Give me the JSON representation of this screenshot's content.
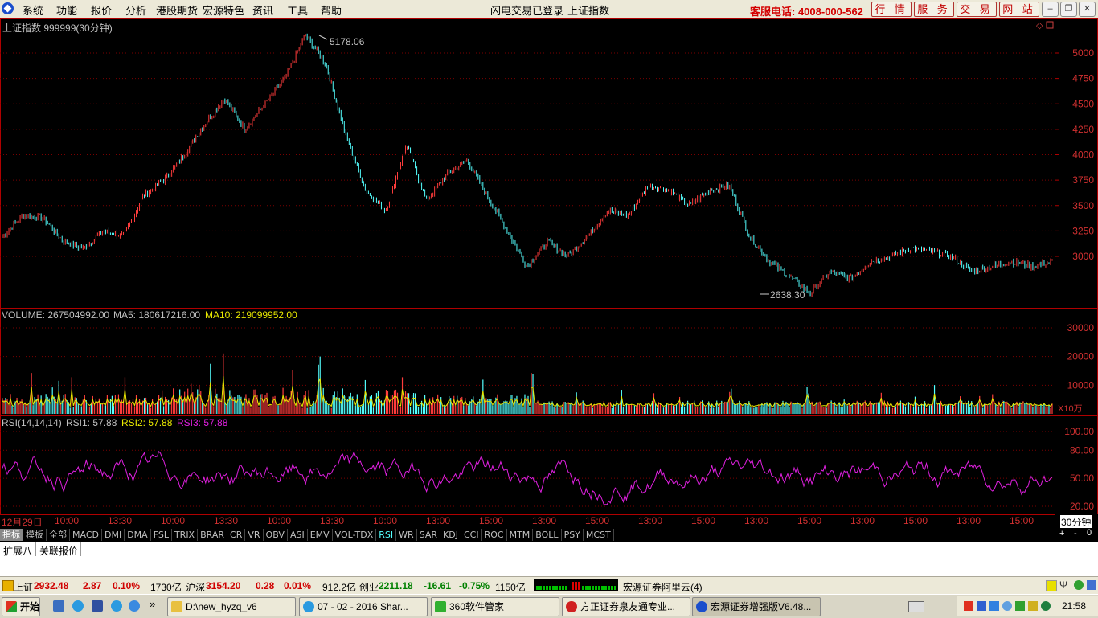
{
  "menu": {
    "items": [
      "系统",
      "功能",
      "报价",
      "分析",
      "港股期货",
      "宏源特色",
      "资讯",
      "工具",
      "帮助"
    ],
    "login_status": "闪电交易已登录",
    "current_index": "上证指数",
    "hotline": "客服电话: 4008-000-562",
    "right_buttons": [
      "行 情",
      "服 务",
      "交 易",
      "网 站"
    ]
  },
  "chart_header": {
    "title": "上证指数 999999(30分钟)",
    "high_label": "5178.06",
    "low_label": "2638.30",
    "price_ticks": [
      "5000",
      "4750",
      "4500",
      "4250",
      "4000",
      "3750",
      "3500",
      "3250",
      "3000"
    ]
  },
  "volume": {
    "label": "VOLUME: 267504992.00",
    "ma5": "MA5: 180617216.00",
    "ma10": "MA10: 219099952.00",
    "ticks": [
      "30000",
      "20000",
      "10000"
    ],
    "unit": "X10万"
  },
  "rsi": {
    "label": "RSI(14,14,14)",
    "rsi1": "RSI1: 57.88",
    "rsi2": "RSI2: 57.88",
    "rsi3": "RSI3: 57.88",
    "ticks": [
      "100.00",
      "80.00",
      "50.00",
      "20.00"
    ]
  },
  "time_axis": {
    "first": "12月29日",
    "labels": [
      "10:00",
      "13:30",
      "10:00",
      "13:30",
      "10:00",
      "13:30",
      "10:00",
      "13:00",
      "15:00",
      "13:00",
      "15:00",
      "13:00",
      "15:00",
      "13:00",
      "15:00",
      "13:00",
      "15:00",
      "13:00",
      "15:00"
    ],
    "period": "30分钟"
  },
  "indicator_tabs": [
    "指标",
    "模板",
    "全部",
    "MACD",
    "DMI",
    "DMA",
    "FSL",
    "TRIX",
    "BRAR",
    "CR",
    "VR",
    "OBV",
    "ASI",
    "EMV",
    "VOL-TDX",
    "RSI",
    "WR",
    "SAR",
    "KDJ",
    "CCI",
    "ROC",
    "MTM",
    "BOLL",
    "PSY",
    "MCST"
  ],
  "active_tab": "RSI",
  "ext_tabs": [
    "扩展八",
    "关联报价"
  ],
  "status": {
    "sh_label": "上证",
    "sh_value": "2932.48",
    "sh_change": "2.87",
    "sh_pct": "0.10%",
    "sh_amount": "1730亿",
    "hs_label": "沪深",
    "hs_value": "3154.20",
    "hs_change": "0.28",
    "hs_pct": "0.01%",
    "hs_amount": "912.2亿",
    "cy_label": "创业",
    "cy_value": "2211.18",
    "cy_change": "-16.61",
    "cy_pct": "-0.75%",
    "cy_amount": "1150亿",
    "server": "宏源证券阿里云(4)"
  },
  "taskbar": {
    "start": "开始",
    "tasks": [
      "D:\\new_hyzq_v6",
      "07 - 02 - 2016 Shar...",
      "360软件管家",
      "方正证券泉友通专业...",
      "宏源证券增强版V6.48..."
    ],
    "clock": "21:58"
  },
  "chart_data": {
    "type": "candlestick",
    "symbol": "999999",
    "period": "30分钟",
    "y_ticks": [
      3000,
      3250,
      3500,
      3750,
      4000,
      4250,
      4500,
      4750,
      5000
    ],
    "high": 5178.06,
    "low": 2638.3,
    "price_path_keypoints": [
      3200,
      3400,
      3380,
      3150,
      3080,
      3250,
      3200,
      3600,
      3750,
      4000,
      4300,
      4550,
      4250,
      4500,
      4750,
      5178,
      4900,
      4200,
      3650,
      3450,
      4100,
      3550,
      3800,
      3950,
      3600,
      3250,
      2900,
      3150,
      3000,
      3200,
      3450,
      3400,
      3700,
      3650,
      3500,
      3650,
      3700,
      3200,
      2950,
      2800,
      2638,
      2850,
      2780,
      2950,
      3000,
      3080,
      3050,
      3000,
      2850,
      2900,
      2950,
      2900,
      2950
    ]
  }
}
